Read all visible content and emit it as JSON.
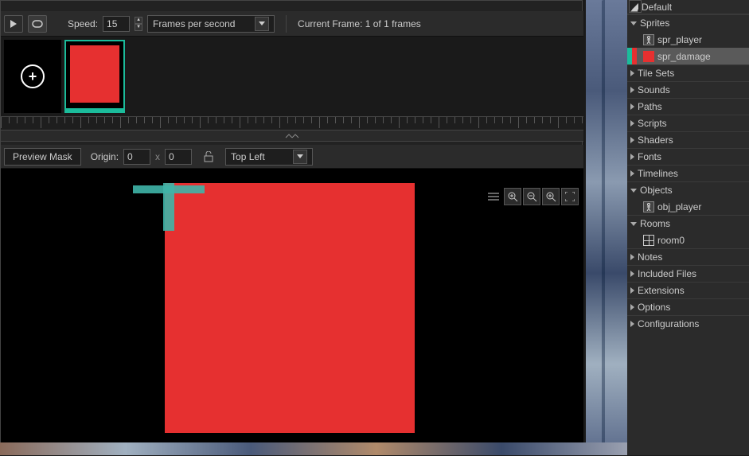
{
  "toolbar": {
    "speed_label": "Speed:",
    "speed_value": "15",
    "fps_label": "Frames per second",
    "current_frame": "Current Frame: 1 of 1 frames"
  },
  "origin_bar": {
    "preview_mask": "Preview Mask",
    "origin_label": "Origin:",
    "origin_x": "0",
    "origin_y": "0",
    "anchor": "Top Left"
  },
  "sprite_color": "#e63030",
  "accent_color": "#1bbc9b",
  "resources": {
    "default": "Default",
    "folders": [
      {
        "name": "Sprites",
        "expanded": true,
        "items": [
          {
            "name": "spr_player",
            "icon": "stick"
          },
          {
            "name": "spr_damage",
            "icon": "red",
            "selected": true
          }
        ]
      },
      {
        "name": "Tile Sets",
        "expanded": false
      },
      {
        "name": "Sounds",
        "expanded": false
      },
      {
        "name": "Paths",
        "expanded": false
      },
      {
        "name": "Scripts",
        "expanded": false
      },
      {
        "name": "Shaders",
        "expanded": false
      },
      {
        "name": "Fonts",
        "expanded": false
      },
      {
        "name": "Timelines",
        "expanded": false
      },
      {
        "name": "Objects",
        "expanded": true,
        "items": [
          {
            "name": "obj_player",
            "icon": "stick"
          }
        ]
      },
      {
        "name": "Rooms",
        "expanded": true,
        "items": [
          {
            "name": "room0",
            "icon": "room"
          }
        ]
      },
      {
        "name": "Notes",
        "expanded": false
      },
      {
        "name": "Included Files",
        "expanded": false
      },
      {
        "name": "Extensions",
        "expanded": false
      },
      {
        "name": "Options",
        "expanded": false
      },
      {
        "name": "Configurations",
        "expanded": false
      }
    ]
  }
}
